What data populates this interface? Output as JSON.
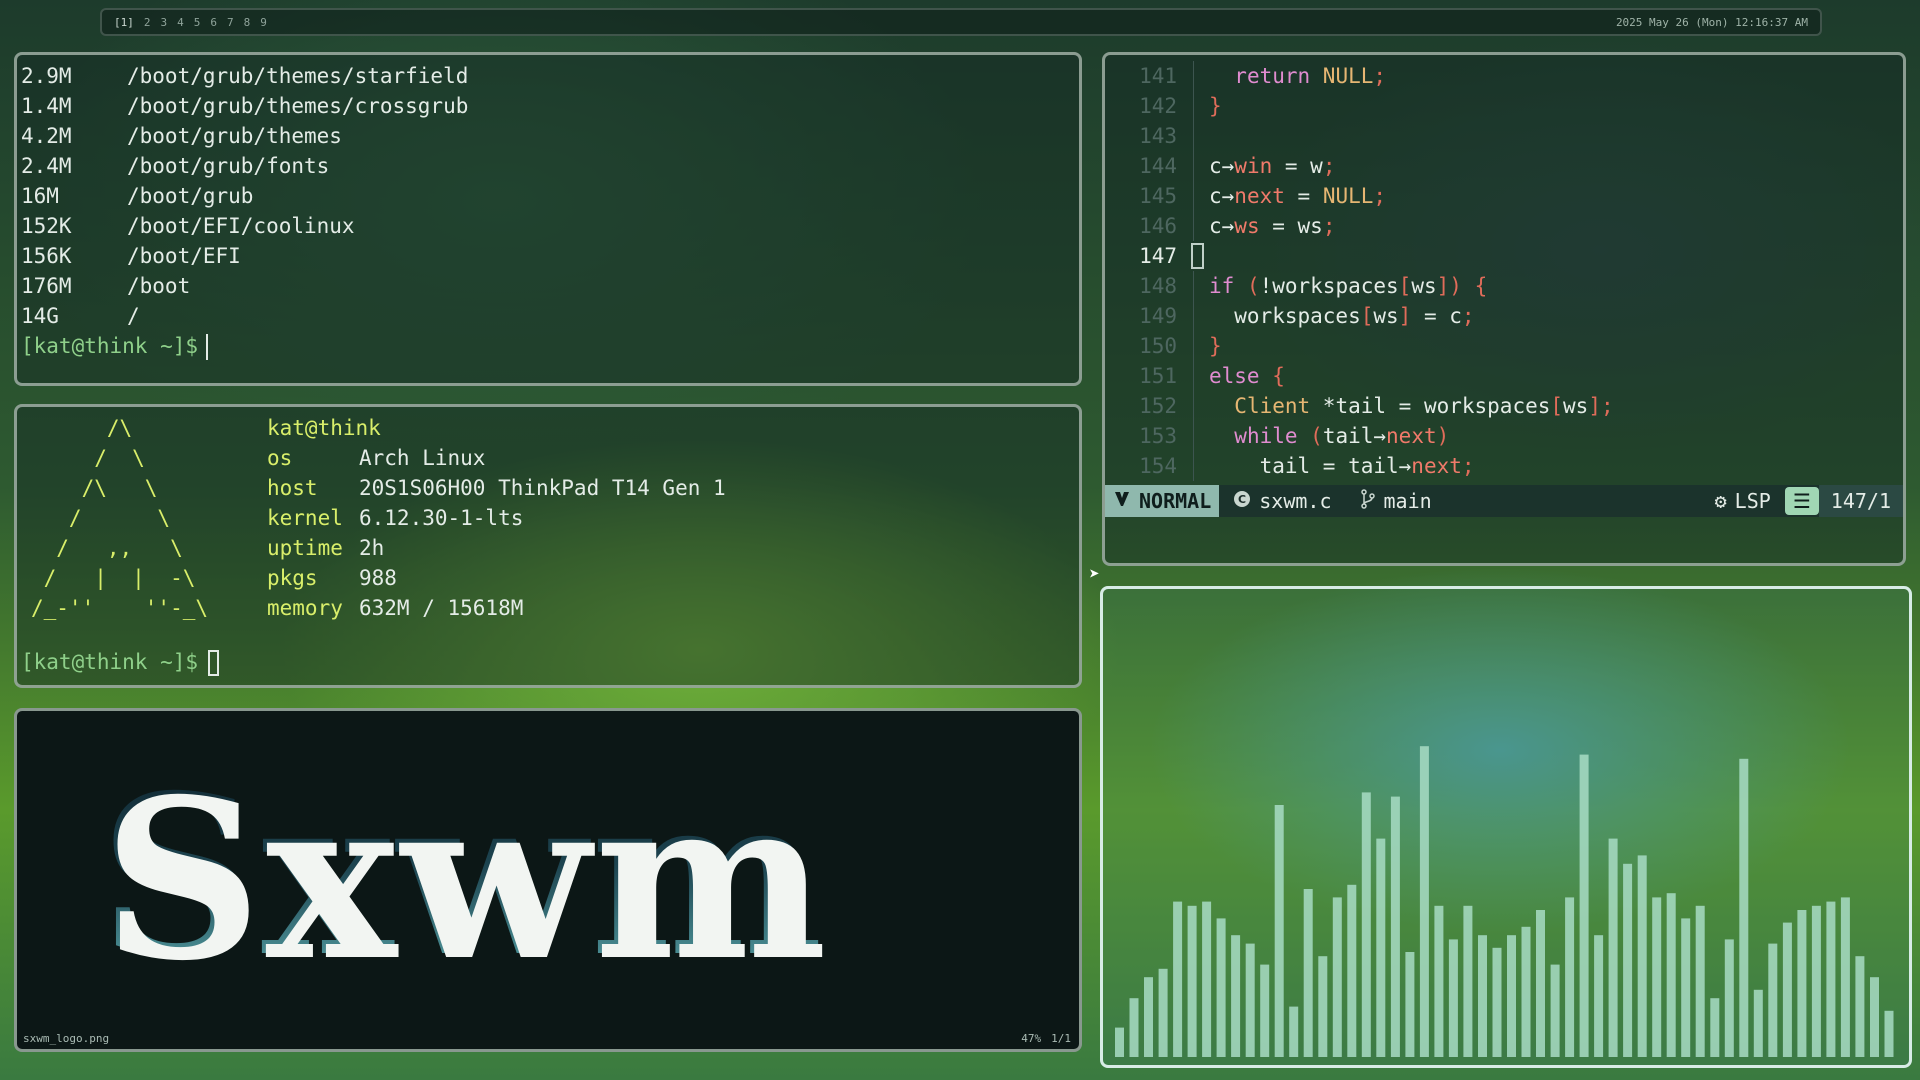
{
  "bar": {
    "workspaces": [
      "[1]",
      "2",
      "3",
      "4",
      "5",
      "6",
      "7",
      "8",
      "9"
    ],
    "datetime": "2025 May 26 (Mon) 12:16:37 AM"
  },
  "du_terminal": {
    "rows": [
      {
        "size": "2.9M",
        "path": "/boot/grub/themes/starfield"
      },
      {
        "size": "1.4M",
        "path": "/boot/grub/themes/crossgrub"
      },
      {
        "size": "4.2M",
        "path": "/boot/grub/themes"
      },
      {
        "size": "2.4M",
        "path": "/boot/grub/fonts"
      },
      {
        "size": "16M",
        "path": "/boot/grub"
      },
      {
        "size": "152K",
        "path": "/boot/EFI/coolinux"
      },
      {
        "size": "156K",
        "path": "/boot/EFI"
      },
      {
        "size": "176M",
        "path": "/boot"
      },
      {
        "size": "14G",
        "path": "/"
      }
    ],
    "prompt": "[kat@think ~]$"
  },
  "fetch_terminal": {
    "ascii": "      /\\\n     /  \\\n    /\\   \\\n   /      \\\n  /   ,,   \\\n /   |  |  -\\\n/_-''    ''-_\\",
    "title": "kat@think",
    "info": [
      {
        "key": "os",
        "value": "Arch Linux"
      },
      {
        "key": "host",
        "value": "20S1S06H00 ThinkPad T14 Gen 1"
      },
      {
        "key": "kernel",
        "value": "6.12.30-1-lts"
      },
      {
        "key": "uptime",
        "value": "2h"
      },
      {
        "key": "pkgs",
        "value": "988"
      },
      {
        "key": "memory",
        "value": "632M / 15618M"
      }
    ],
    "prompt": "[kat@think ~]$"
  },
  "editor": {
    "lines": [
      {
        "num": "141",
        "tokens": [
          {
            "t": "  ",
            "c": "tx"
          },
          {
            "t": "return",
            "c": "kw"
          },
          {
            "t": " NULL",
            "c": "ty"
          },
          {
            "t": ";",
            "c": "pn"
          }
        ]
      },
      {
        "num": "142",
        "tokens": [
          {
            "t": "}",
            "c": "pn"
          }
        ]
      },
      {
        "num": "143",
        "tokens": []
      },
      {
        "num": "144",
        "tokens": [
          {
            "t": "c→",
            "c": "tx"
          },
          {
            "t": "win",
            "c": "fld"
          },
          {
            "t": " = w",
            "c": "tx"
          },
          {
            "t": ";",
            "c": "pn"
          }
        ]
      },
      {
        "num": "145",
        "tokens": [
          {
            "t": "c→",
            "c": "tx"
          },
          {
            "t": "next",
            "c": "fld"
          },
          {
            "t": " = ",
            "c": "tx"
          },
          {
            "t": "NULL",
            "c": "ty"
          },
          {
            "t": ";",
            "c": "pn"
          }
        ]
      },
      {
        "num": "146",
        "tokens": [
          {
            "t": "c→",
            "c": "tx"
          },
          {
            "t": "ws",
            "c": "fld"
          },
          {
            "t": " = ws",
            "c": "tx"
          },
          {
            "t": ";",
            "c": "pn"
          }
        ]
      },
      {
        "num": "147",
        "current": true,
        "tokens": []
      },
      {
        "num": "148",
        "tokens": [
          {
            "t": "if",
            "c": "kw"
          },
          {
            "t": " (",
            "c": "pn"
          },
          {
            "t": "!workspaces",
            "c": "tx"
          },
          {
            "t": "[",
            "c": "pn"
          },
          {
            "t": "ws",
            "c": "tx"
          },
          {
            "t": "]",
            "c": "pn"
          },
          {
            "t": ") {",
            "c": "pn"
          }
        ]
      },
      {
        "num": "149",
        "tokens": [
          {
            "t": "  workspaces",
            "c": "tx"
          },
          {
            "t": "[",
            "c": "pn"
          },
          {
            "t": "ws",
            "c": "tx"
          },
          {
            "t": "]",
            "c": "pn"
          },
          {
            "t": " = c",
            "c": "tx"
          },
          {
            "t": ";",
            "c": "pn"
          }
        ]
      },
      {
        "num": "150",
        "tokens": [
          {
            "t": "}",
            "c": "pn"
          }
        ]
      },
      {
        "num": "151",
        "tokens": [
          {
            "t": "else",
            "c": "kw"
          },
          {
            "t": " {",
            "c": "pn"
          }
        ]
      },
      {
        "num": "152",
        "tokens": [
          {
            "t": "  ",
            "c": "tx"
          },
          {
            "t": "Client",
            "c": "ty"
          },
          {
            "t": " *tail = workspaces",
            "c": "tx"
          },
          {
            "t": "[",
            "c": "pn"
          },
          {
            "t": "ws",
            "c": "tx"
          },
          {
            "t": "]",
            "c": "pn"
          },
          {
            "t": ";",
            "c": "pn"
          }
        ]
      },
      {
        "num": "153",
        "tokens": [
          {
            "t": "  ",
            "c": "tx"
          },
          {
            "t": "while",
            "c": "kw"
          },
          {
            "t": " (",
            "c": "pn"
          },
          {
            "t": "tail→",
            "c": "tx"
          },
          {
            "t": "next",
            "c": "fld"
          },
          {
            "t": ")",
            "c": "pn"
          }
        ]
      },
      {
        "num": "154",
        "tokens": [
          {
            "t": "    tail = tail→",
            "c": "tx"
          },
          {
            "t": "next",
            "c": "fld"
          },
          {
            "t": ";",
            "c": "pn"
          }
        ]
      }
    ],
    "status": {
      "mode_icon": "vim-icon",
      "mode": "NORMAL",
      "file_icon": "c-file-icon",
      "file": "sxwm.c",
      "branch_icon": "git-branch-icon",
      "branch": "main",
      "lsp_icon": "gears-icon",
      "lsp": "LSP",
      "position_icon": "lines-icon",
      "position": "147/1"
    }
  },
  "viewer": {
    "logo_text": "Sxwm",
    "filename": "sxwm_logo.png",
    "zoom": "47%",
    "page": "1/1"
  },
  "visualizer": {
    "bar_color": "#a8dcc4",
    "levels": [
      0.07,
      0.14,
      0.19,
      0.21,
      0.37,
      0.36,
      0.37,
      0.33,
      0.29,
      0.27,
      0.22,
      0.6,
      0.12,
      0.4,
      0.24,
      0.38,
      0.41,
      0.63,
      0.52,
      0.62,
      0.25,
      0.74,
      0.36,
      0.28,
      0.36,
      0.29,
      0.26,
      0.29,
      0.31,
      0.35,
      0.22,
      0.38,
      0.72,
      0.29,
      0.52,
      0.46,
      0.48,
      0.38,
      0.39,
      0.33,
      0.36,
      0.14,
      0.28,
      0.71,
      0.16,
      0.27,
      0.32,
      0.35,
      0.36,
      0.37,
      0.38,
      0.24,
      0.19,
      0.11
    ]
  }
}
